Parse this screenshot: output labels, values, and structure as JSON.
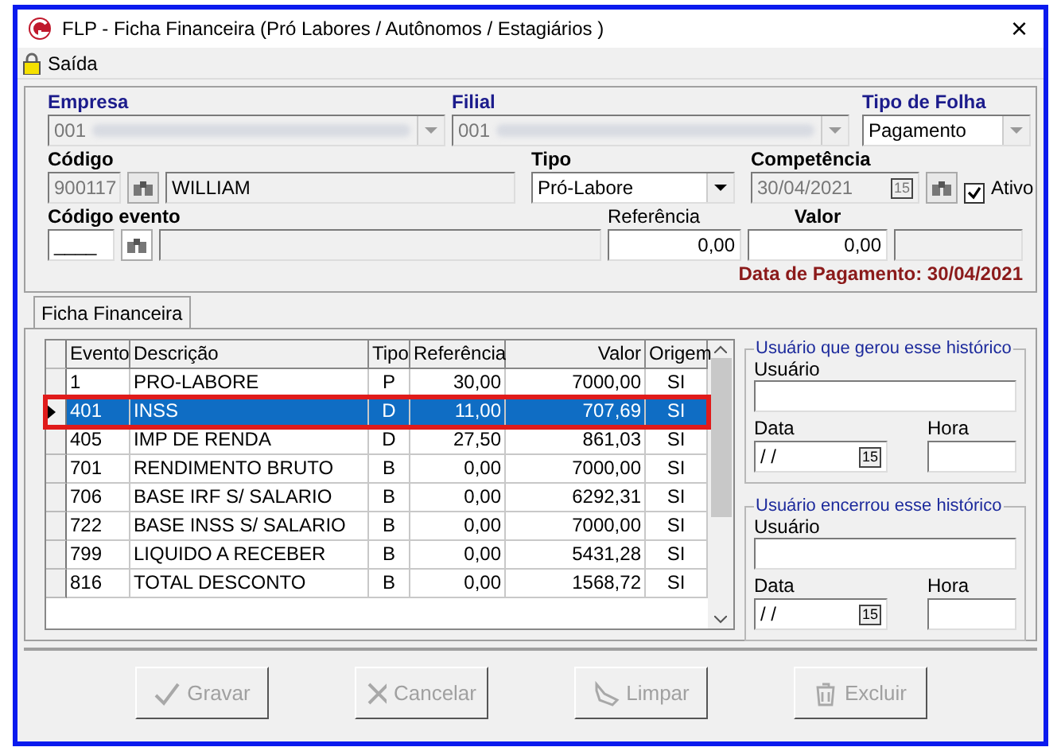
{
  "window": {
    "title": "FLP - Ficha Financeira (Pró Labores / Autônomos / Estagiários )",
    "close": "×"
  },
  "menu": [
    {
      "label": "Saída"
    }
  ],
  "header": {
    "empresa": {
      "label": "Empresa",
      "value": "001"
    },
    "filial": {
      "label": "Filial",
      "value": "001"
    },
    "tipo_folha": {
      "label": "Tipo de Folha",
      "value": "Pagamento"
    },
    "codigo": {
      "label": "Código",
      "value": "900117",
      "name": "WILLIAM"
    },
    "tipo": {
      "label": "Tipo",
      "value": "Pró-Labore"
    },
    "competencia": {
      "label": "Competência",
      "value": "30/04/2021",
      "calendar": "15"
    },
    "ativo": {
      "label": "Ativo",
      "checked": true
    },
    "codigo_evento": {
      "label": "Código evento",
      "value": "____"
    },
    "referencia": {
      "label": "Referência",
      "value": "0,00"
    },
    "valor": {
      "label": "Valor",
      "value": "0,00"
    },
    "data_pagamento": "Data de Pagamento: 30/04/2021"
  },
  "tabs": [
    {
      "label": "Ficha Financeira",
      "selected": true
    }
  ],
  "table": {
    "columns": [
      "Evento",
      "Descrição",
      "Tipo",
      "Referência",
      "Valor",
      "Origem"
    ],
    "rows": [
      {
        "cells": [
          "1",
          "PRO-LABORE",
          "P",
          "30,00",
          "7000,00",
          "SI"
        ],
        "selected": false
      },
      {
        "cells": [
          "401",
          "INSS",
          "D",
          "11,00",
          "707,69",
          "SI"
        ],
        "selected": true
      },
      {
        "cells": [
          "405",
          "IMP DE RENDA",
          "D",
          "27,50",
          "861,03",
          "SI"
        ],
        "selected": false
      },
      {
        "cells": [
          "701",
          "RENDIMENTO BRUTO",
          "B",
          "0,00",
          "7000,00",
          "SI"
        ],
        "selected": false
      },
      {
        "cells": [
          "706",
          "BASE IRF S/ SALARIO",
          "B",
          "0,00",
          "6292,31",
          "SI"
        ],
        "selected": false
      },
      {
        "cells": [
          "722",
          "BASE INSS S/ SALARIO",
          "B",
          "0,00",
          "7000,00",
          "SI"
        ],
        "selected": false
      },
      {
        "cells": [
          "799",
          "LIQUIDO A RECEBER",
          "B",
          "0,00",
          "5431,28",
          "SI"
        ],
        "selected": false
      },
      {
        "cells": [
          "816",
          "TOTAL DESCONTO",
          "B",
          "0,00",
          "1568,72",
          "SI"
        ],
        "selected": false
      }
    ]
  },
  "history_groups": [
    {
      "title": "Usuário que gerou esse histórico",
      "user_label": "Usuário",
      "date_label": "Data",
      "date_value": "/ /",
      "calendar": "15",
      "time_label": "Hora"
    },
    {
      "title": "Usuário encerrou esse histórico",
      "user_label": "Usuário",
      "date_label": "Data",
      "date_value": "/ /",
      "calendar": "15",
      "time_label": "Hora"
    }
  ],
  "buttons": [
    {
      "label": "Gravar",
      "kind": "check",
      "disabled": true
    },
    {
      "label": "Cancelar",
      "kind": "cross",
      "disabled": true
    },
    {
      "label": "Limpar",
      "kind": "broom",
      "disabled": true
    },
    {
      "label": "Excluir",
      "kind": "trash",
      "disabled": true
    }
  ]
}
